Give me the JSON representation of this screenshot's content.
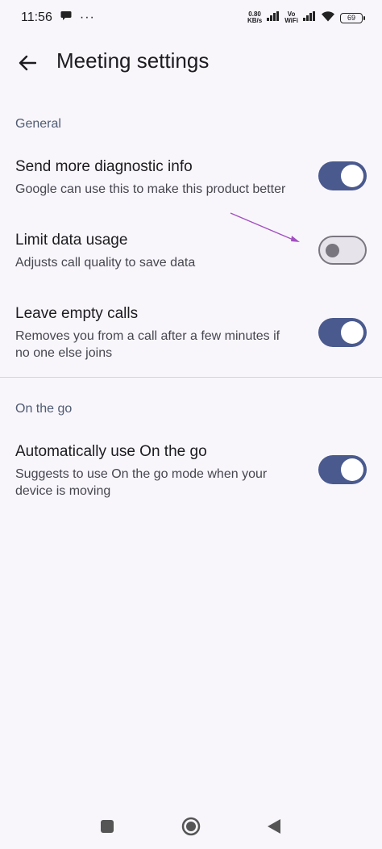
{
  "status_bar": {
    "time": "11:56",
    "net_speed_value": "0.80",
    "net_speed_unit": "KB/s",
    "volte_top": "Vo",
    "volte_bottom": "WiFi",
    "battery": "69"
  },
  "header": {
    "title": "Meeting settings",
    "back_icon": "arrow-back-icon"
  },
  "sections": {
    "general": {
      "label": "General",
      "items": [
        {
          "title": "Send more diagnostic info",
          "subtitle": "Google can use this to make this product better",
          "enabled": true
        },
        {
          "title": "Limit data usage",
          "subtitle": "Adjusts call quality to save data",
          "enabled": false
        },
        {
          "title": "Leave empty calls",
          "subtitle": "Removes you from a call after a few minutes if no one else joins",
          "enabled": true
        }
      ]
    },
    "on_the_go": {
      "label": "On the go",
      "items": [
        {
          "title": "Automatically use On the go",
          "subtitle": "Suggests to use On the go mode when your device is moving",
          "enabled": true
        }
      ]
    }
  },
  "colors": {
    "background": "#f8f6fb",
    "toggle_on": "#4a5a8e",
    "toggle_off_border": "#7a7680",
    "annotation_arrow": "#a24fc0"
  },
  "nav_bar": {
    "icons": [
      "recents-square-icon",
      "home-circle-icon",
      "back-triangle-icon"
    ]
  }
}
